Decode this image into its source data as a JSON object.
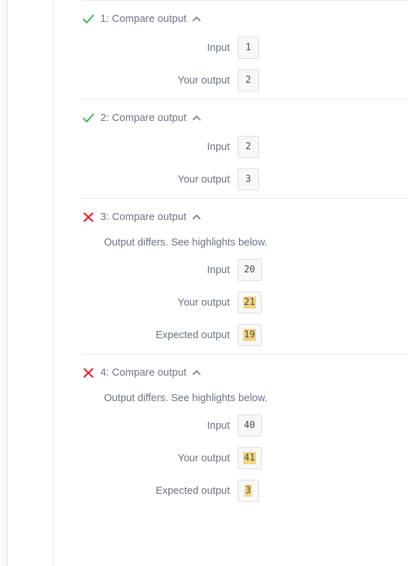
{
  "panel": {
    "name": "test-results-panel"
  },
  "test_cases": [
    {
      "status": "pass",
      "status_icon": "green-check-icon",
      "title": "1: Compare output",
      "chevron_icon": "chevron-up-icon",
      "message": null,
      "fields": [
        {
          "label": "Input",
          "value": "1",
          "highlighted": false
        },
        {
          "label": "Your output",
          "value": "2",
          "highlighted": false
        }
      ]
    },
    {
      "status": "pass",
      "status_icon": "green-check-icon",
      "title": "2: Compare output",
      "chevron_icon": "chevron-up-icon",
      "message": null,
      "fields": [
        {
          "label": "Input",
          "value": "2",
          "highlighted": false
        },
        {
          "label": "Your output",
          "value": "3",
          "highlighted": false
        }
      ]
    },
    {
      "status": "fail",
      "status_icon": "red-x-icon",
      "title": "3: Compare output",
      "chevron_icon": "chevron-up-icon",
      "message": "Output differs. See highlights below.",
      "fields": [
        {
          "label": "Input",
          "value": "20",
          "highlighted": false
        },
        {
          "label": "Your output",
          "value": "21",
          "highlighted": true
        },
        {
          "label": "Expected output",
          "value": "19",
          "highlighted": true
        }
      ]
    },
    {
      "status": "fail",
      "status_icon": "red-x-icon",
      "title": "4: Compare output",
      "chevron_icon": "chevron-up-icon",
      "message": "Output differs. See highlights below.",
      "fields": [
        {
          "label": "Input",
          "value": "40",
          "highlighted": false
        },
        {
          "label": "Your output",
          "value": "41",
          "highlighted": true
        },
        {
          "label": "Expected output",
          "value": "3",
          "highlighted": true
        }
      ]
    }
  ],
  "colors": {
    "pass": "#44b556",
    "fail": "#ed1c24",
    "highlight": "#f2d479",
    "label_text": "#6b7280",
    "value_text": "#4a4a55",
    "box_border": "#dcdcdc",
    "box_fill": "#f8f8f8",
    "divider": "#e6e6e6"
  }
}
